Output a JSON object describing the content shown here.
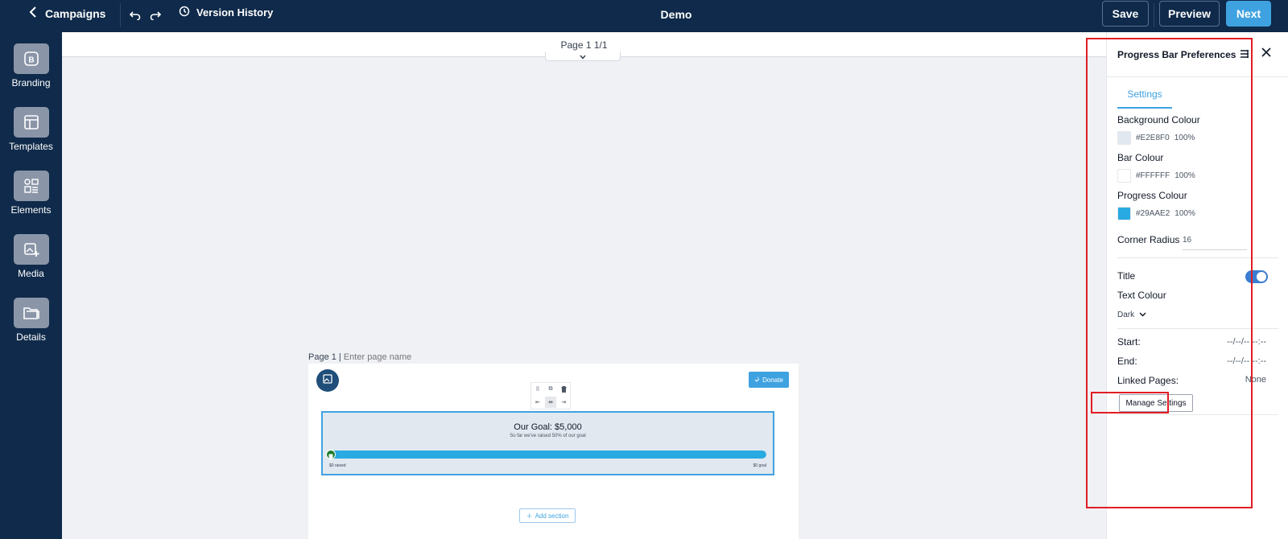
{
  "topbar": {
    "back_label": "Campaigns",
    "history_label": "Version History",
    "title": "Demo",
    "save_label": "Save",
    "preview_label": "Preview",
    "next_label": "Next"
  },
  "sidebar": {
    "items": [
      {
        "label": "Branding",
        "icon": "branding-icon"
      },
      {
        "label": "Templates",
        "icon": "templates-icon"
      },
      {
        "label": "Elements",
        "icon": "elements-icon"
      },
      {
        "label": "Media",
        "icon": "media-icon"
      },
      {
        "label": "Details",
        "icon": "details-icon"
      }
    ]
  },
  "canvas": {
    "page_indicator": "Page 1 1/1",
    "page_label": "Page 1 |",
    "page_name_placeholder": "Enter page name",
    "donate_label": "Donate",
    "add_section_label": "Add section",
    "progress": {
      "title": "Our Goal: $5,000",
      "subtitle": "So far we've raised 50% of our goal",
      "left_label": "$0 raised",
      "right_label": "$0 goal",
      "fill_fraction": 1.0
    }
  },
  "panel": {
    "title": "Progress Bar Preferences",
    "tab_settings": "Settings",
    "background_colour": {
      "label": "Background Colour",
      "hex": "#E2E8F0",
      "opacity": "100%"
    },
    "bar_colour": {
      "label": "Bar Colour",
      "hex": "#FFFFFF",
      "opacity": "100%"
    },
    "progress_colour": {
      "label": "Progress Colour",
      "hex": "#29AAE2",
      "opacity": "100%"
    },
    "corner_radius": {
      "label": "Corner Radius",
      "value": "16"
    },
    "title_toggle": {
      "label": "Title",
      "on": true
    },
    "text_colour": {
      "label": "Text Colour",
      "value": "Dark"
    },
    "start": {
      "label": "Start:",
      "value": "--/--/-- --:--"
    },
    "end": {
      "label": "End:",
      "value": "--/--/-- --:--"
    },
    "linked_pages": {
      "label": "Linked Pages:",
      "value": "None"
    },
    "manage_settings_label": "Manage Settings"
  },
  "colors": {
    "navy": "#0f2a4a",
    "accent": "#3fa2e0",
    "highlight": "#e11d24"
  }
}
